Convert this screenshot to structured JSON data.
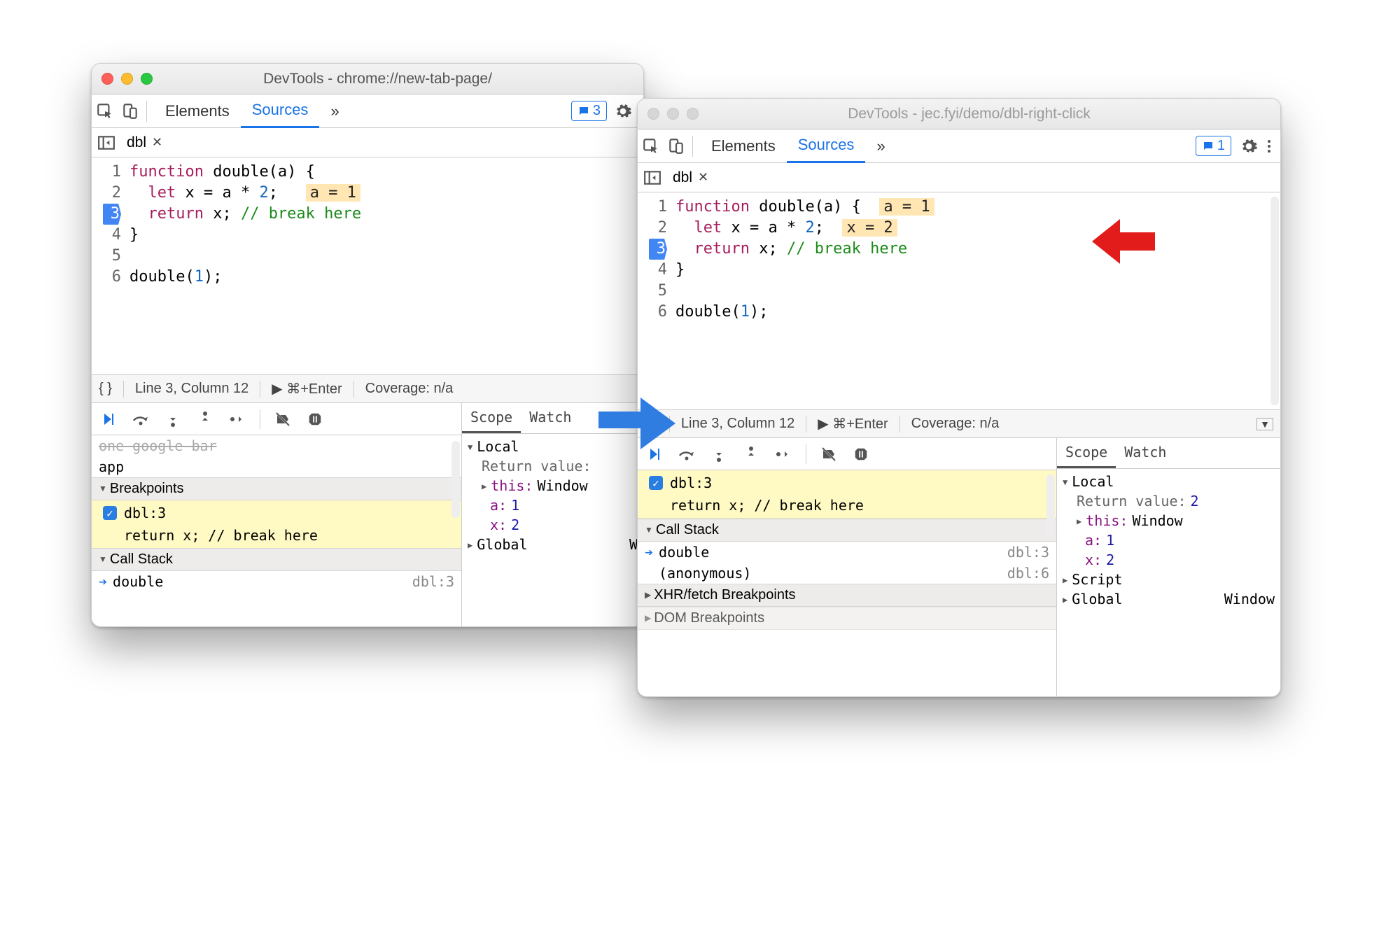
{
  "win1": {
    "title": "DevTools - chrome://new-tab-page/",
    "nav": {
      "elements": "Elements",
      "sources": "Sources"
    },
    "badge_count": "3",
    "filetab": "dbl",
    "code": {
      "l1a": "function",
      "l1b": " double(a) {",
      "l2a": "  let",
      "l2b": " x = a * ",
      "l2c": "2",
      "l2d": ";   ",
      "l2hint": "a = 1",
      "l3a": "  return",
      "l3b": " x; ",
      "l3cmt": "// break here",
      "l4": "}",
      "l6a": "double(",
      "l6b": "1",
      "l6c": ");"
    },
    "status": {
      "pos": "Line 3, Column 12",
      "run": "▶ ⌘+Enter",
      "cov": "Coverage: n/a"
    },
    "panes": {
      "row_trunc": "one google bar",
      "app": "app",
      "breakpoints": "Breakpoints",
      "bp_file": "dbl:3",
      "bp_line": "return x; // break here",
      "callstack": "Call Stack",
      "cs_name": "double",
      "cs_loc": "dbl:3"
    },
    "scope_tabs": {
      "scope": "Scope",
      "watch": "Watch"
    },
    "scope": {
      "local": "Local",
      "retlbl": "Return value:",
      "thislbl": "this:",
      "thisval": "Window",
      "alabel": "a:",
      "aval": "1",
      "xlabel": "x:",
      "xval": "2",
      "global": "Global",
      "globalval": "W"
    }
  },
  "win2": {
    "title": "DevTools - jec.fyi/demo/dbl-right-click",
    "nav": {
      "elements": "Elements",
      "sources": "Sources"
    },
    "badge_count": "1",
    "filetab": "dbl",
    "code": {
      "l1a": "function",
      "l1b": " double(a) {  ",
      "l1hint": "a = 1",
      "l2a": "  let",
      "l2b": " x = a * ",
      "l2c": "2",
      "l2d": ";  ",
      "l2hint": "x = 2",
      "l3a": "  return",
      "l3b": " x; ",
      "l3cmt": "// break here",
      "l4": "}",
      "l6a": "double(",
      "l6b": "1",
      "l6c": ");"
    },
    "status": {
      "pos": "Line 3, Column 12",
      "run": "▶ ⌘+Enter",
      "cov": "Coverage: n/a"
    },
    "panes": {
      "bp_file": "dbl:3",
      "bp_line": "return x; // break here",
      "callstack": "Call Stack",
      "cs1_name": "double",
      "cs1_loc": "dbl:3",
      "cs2_name": "(anonymous)",
      "cs2_loc": "dbl:6",
      "xhr": "XHR/fetch Breakpoints",
      "dom": "DOM Breakpoints"
    },
    "scope_tabs": {
      "scope": "Scope",
      "watch": "Watch"
    },
    "scope": {
      "local": "Local",
      "retlbl": "Return value:",
      "retval": "2",
      "thislbl": "this:",
      "thisval": "Window",
      "alabel": "a:",
      "aval": "1",
      "xlabel": "x:",
      "xval": "2",
      "script": "Script",
      "global": "Global",
      "globalval": "Window"
    }
  }
}
